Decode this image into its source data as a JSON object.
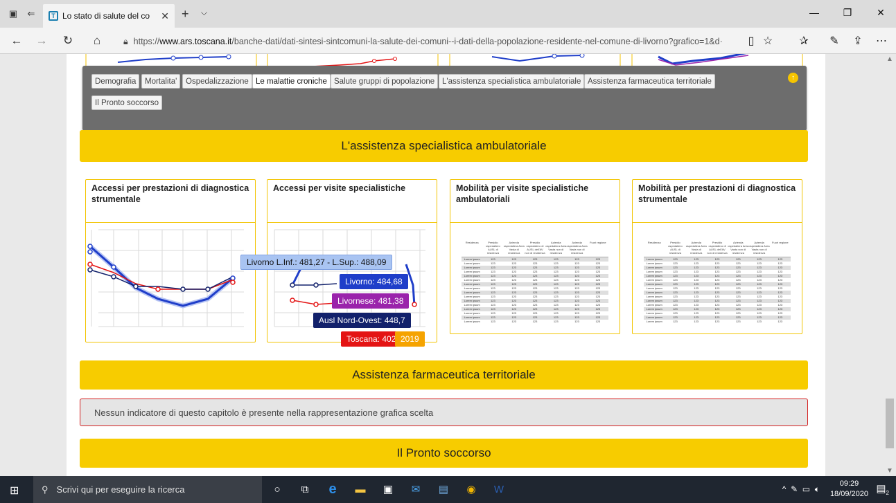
{
  "browser": {
    "tab_title": "Lo stato di salute del co",
    "url_prefix": "https://",
    "url_domain": "www.ars.toscana.it",
    "url_path": "/banche-dati/dati-sintesi-sintcomuni-la-salute-dei-comuni--i-dati-della-popolazione-residente-nel-comune-di-livorno?grafico=1&d·"
  },
  "menu": {
    "items": [
      "Demografia",
      "Mortalita'",
      "Ospedalizzazione",
      "Le malattie croniche",
      "Salute gruppi di popolazione",
      "L'assistenza specialistica ambulatoriale",
      "Assistenza farmaceutica territoriale",
      "Il Pronto soccorso"
    ],
    "active_index": 3
  },
  "sections": {
    "specialistica": "L'assistenza specialistica ambulatoriale",
    "farmaceutica": "Assistenza farmaceutica territoriale",
    "pronto": "Il Pronto soccorso"
  },
  "panels": [
    {
      "title": "Accessi per prestazioni di diagnostica strumentale"
    },
    {
      "title": "Accessi per visite specialistiche"
    },
    {
      "title": "Mobilità per visite specialistiche ambulatoriali"
    },
    {
      "title": "Mobilità per prestazioni di diagnostica strumentale"
    }
  ],
  "tooltip": {
    "interval": "Livorno L.Inf.: 481,27 - L.Sup.: 488,09",
    "livorno": "Livorno: 484,68",
    "livornese": "Livornese: 481,38",
    "ausl": "Ausl Nord-Ovest: 448,7",
    "toscana": "Toscana: 402",
    "year": "2019"
  },
  "notice": "Nessun indicatore di questo capitolo è presente nella rappresentazione grafica scelta",
  "taskbar": {
    "search_placeholder": "Scrivi qui per eseguire la ricerca",
    "time": "09:29",
    "date": "18/09/2020",
    "notifications": "2"
  },
  "colors": {
    "accent_yellow": "#f7cc00",
    "livorno": "#1f3ec9",
    "livornese": "#9a23ab",
    "ausl": "#12216b",
    "toscana": "#e41414",
    "year": "#f5a300",
    "interval": "#a9c4f2"
  }
}
